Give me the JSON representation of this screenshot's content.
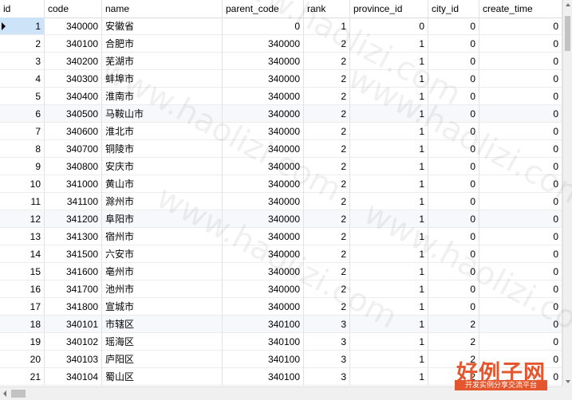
{
  "columns": [
    "id",
    "code",
    "name",
    "parent_code",
    "rank",
    "province_id",
    "city_id",
    "create_time"
  ],
  "rows": [
    [
      "1",
      "340000",
      "安徽省",
      "0",
      "1",
      "0",
      "0",
      "0"
    ],
    [
      "2",
      "340100",
      "合肥市",
      "340000",
      "2",
      "1",
      "0",
      "0"
    ],
    [
      "3",
      "340200",
      "芜湖市",
      "340000",
      "2",
      "1",
      "0",
      "0"
    ],
    [
      "4",
      "340300",
      "蚌埠市",
      "340000",
      "2",
      "1",
      "0",
      "0"
    ],
    [
      "5",
      "340400",
      "淮南市",
      "340000",
      "2",
      "1",
      "0",
      "0"
    ],
    [
      "6",
      "340500",
      "马鞍山市",
      "340000",
      "2",
      "1",
      "0",
      "0"
    ],
    [
      "7",
      "340600",
      "淮北市",
      "340000",
      "2",
      "1",
      "0",
      "0"
    ],
    [
      "8",
      "340700",
      "铜陵市",
      "340000",
      "2",
      "1",
      "0",
      "0"
    ],
    [
      "9",
      "340800",
      "安庆市",
      "340000",
      "2",
      "1",
      "0",
      "0"
    ],
    [
      "10",
      "341000",
      "黄山市",
      "340000",
      "2",
      "1",
      "0",
      "0"
    ],
    [
      "11",
      "341100",
      "滁州市",
      "340000",
      "2",
      "1",
      "0",
      "0"
    ],
    [
      "12",
      "341200",
      "阜阳市",
      "340000",
      "2",
      "1",
      "0",
      "0"
    ],
    [
      "13",
      "341300",
      "宿州市",
      "340000",
      "2",
      "1",
      "0",
      "0"
    ],
    [
      "14",
      "341500",
      "六安市",
      "340000",
      "2",
      "1",
      "0",
      "0"
    ],
    [
      "15",
      "341600",
      "亳州市",
      "340000",
      "2",
      "1",
      "0",
      "0"
    ],
    [
      "16",
      "341700",
      "池州市",
      "340000",
      "2",
      "1",
      "0",
      "0"
    ],
    [
      "17",
      "341800",
      "宣城市",
      "340000",
      "2",
      "1",
      "0",
      "0"
    ],
    [
      "18",
      "340101",
      "市辖区",
      "340100",
      "3",
      "1",
      "2",
      "0"
    ],
    [
      "19",
      "340102",
      "瑶海区",
      "340100",
      "3",
      "1",
      "2",
      "0"
    ],
    [
      "20",
      "340103",
      "庐阳区",
      "340100",
      "3",
      "1",
      "2",
      "0"
    ],
    [
      "21",
      "340104",
      "蜀山区",
      "340100",
      "3",
      "1",
      "2",
      "0"
    ]
  ],
  "selected_row": "1",
  "watermark": "www.haolizi.com",
  "logo": {
    "title": "好例子网",
    "subtitle": "开发实例分享交流平台"
  }
}
